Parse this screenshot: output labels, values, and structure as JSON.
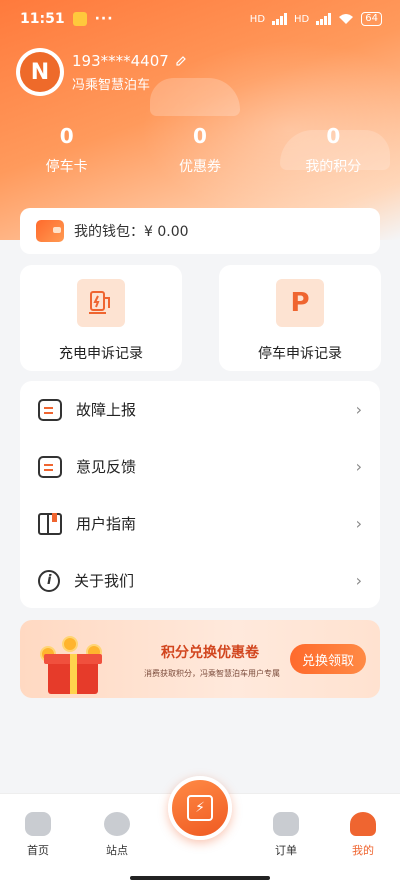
{
  "status_bar": {
    "time": "11:51",
    "dots": "···",
    "net1": "HD",
    "net2": "HD",
    "battery": "64"
  },
  "profile": {
    "phone": "193****4407",
    "brand": "冯乘智慧泊车",
    "avatar_letter": "N"
  },
  "stats": [
    {
      "value": "0",
      "label": "停车卡"
    },
    {
      "value": "0",
      "label": "优惠券"
    },
    {
      "value": "0",
      "label": "我的积分"
    }
  ],
  "wallet": {
    "label": "我的钱包：¥ 0.00"
  },
  "records": {
    "charging": "充电申诉记录",
    "parking": "停车申诉记录",
    "parking_icon": "P"
  },
  "menu": [
    {
      "label": "故障上报",
      "icon": "chat-icon"
    },
    {
      "label": "意见反馈",
      "icon": "chat-icon"
    },
    {
      "label": "用户指南",
      "icon": "book-icon"
    },
    {
      "label": "关于我们",
      "icon": "info-icon"
    }
  ],
  "chevron": "›",
  "promo": {
    "title": "积分兑换优惠卷",
    "subtitle": "消费获取积分，冯乘智慧泊车用户专属",
    "button": "兑换领取"
  },
  "tabs": {
    "home": "首页",
    "site": "站点",
    "order": "订单",
    "mine": "我的"
  },
  "colors": {
    "accent": "#ef6530",
    "hero_start": "#ff7a3c"
  }
}
